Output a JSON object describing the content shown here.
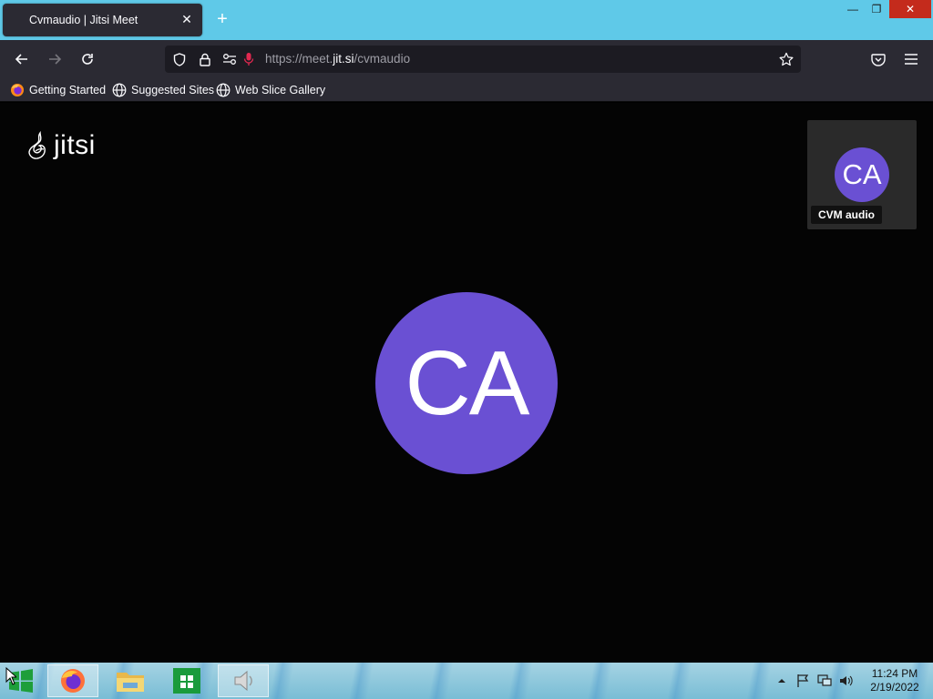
{
  "browser": {
    "tab_title": "Cvmaudio | Jitsi Meet",
    "url_prefix": "https://meet.",
    "url_domain": "jit.si",
    "url_path": "/cvmaudio",
    "bookmarks": [
      "Getting Started",
      "Suggested Sites",
      "Web Slice Gallery"
    ]
  },
  "meeting": {
    "logo_text": "jitsi",
    "main_avatar_initials": "CA",
    "thumbnail_initials": "CA",
    "participant_name": "CVM audio",
    "avatar_color": "#6a50d3"
  },
  "taskbar": {
    "time": "11:24 PM",
    "date": "2/19/2022"
  },
  "icons": [
    "back-icon",
    "forward-icon",
    "reload-icon",
    "shield-icon",
    "lock-icon",
    "permissions-icon",
    "microphone-icon",
    "star-icon",
    "pocket-icon",
    "menu-icon",
    "firefox-icon",
    "globe-icon",
    "windows-start-icon",
    "file-explorer-icon",
    "store-icon",
    "speaker-app-icon",
    "volume-icon",
    "network-icon",
    "flag-icon"
  ]
}
